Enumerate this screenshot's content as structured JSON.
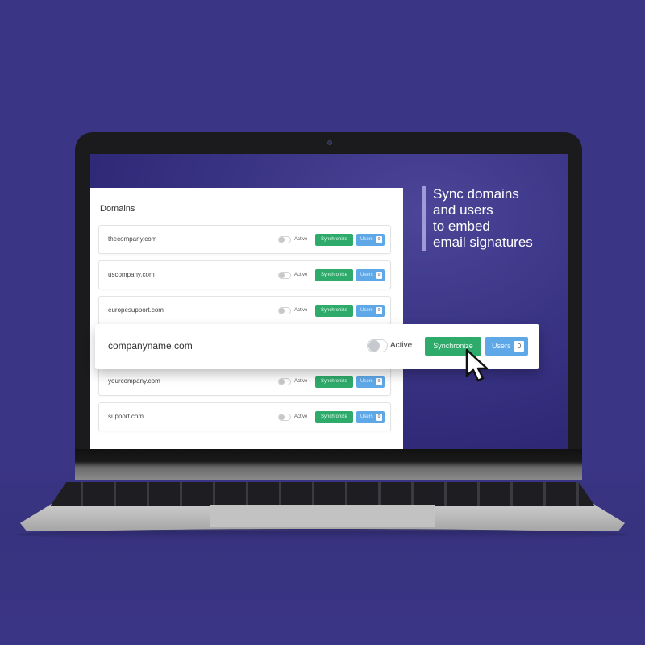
{
  "panel": {
    "title": "Domains",
    "rows": [
      {
        "domain": "thecompany.com",
        "status": "Active",
        "sync": "Synchronize",
        "users": "Users",
        "count": "0"
      },
      {
        "domain": "uscompany.com",
        "status": "Active",
        "sync": "Synchronize",
        "users": "Users",
        "count": "0"
      },
      {
        "domain": "europesupport.com",
        "status": "Active",
        "sync": "Synchronize",
        "users": "Users",
        "count": "0"
      },
      {
        "domain": "yourcompany.com",
        "status": "Active",
        "sync": "Synchronize",
        "users": "Users",
        "count": "0"
      },
      {
        "domain": "support.com",
        "status": "Active",
        "sync": "Synchronize",
        "users": "Users",
        "count": "0"
      }
    ]
  },
  "highlight": {
    "domain": "companyname.com",
    "status": "Active",
    "sync": "Synchronize",
    "users": "Users",
    "count": "0"
  },
  "tagline": {
    "lines": [
      "Sync domains",
      "and users",
      "to embed",
      "email signatures"
    ]
  },
  "colors": {
    "background": "#3a3585",
    "sync_green": "#2eaa6b",
    "users_blue": "#5fa8e8"
  }
}
